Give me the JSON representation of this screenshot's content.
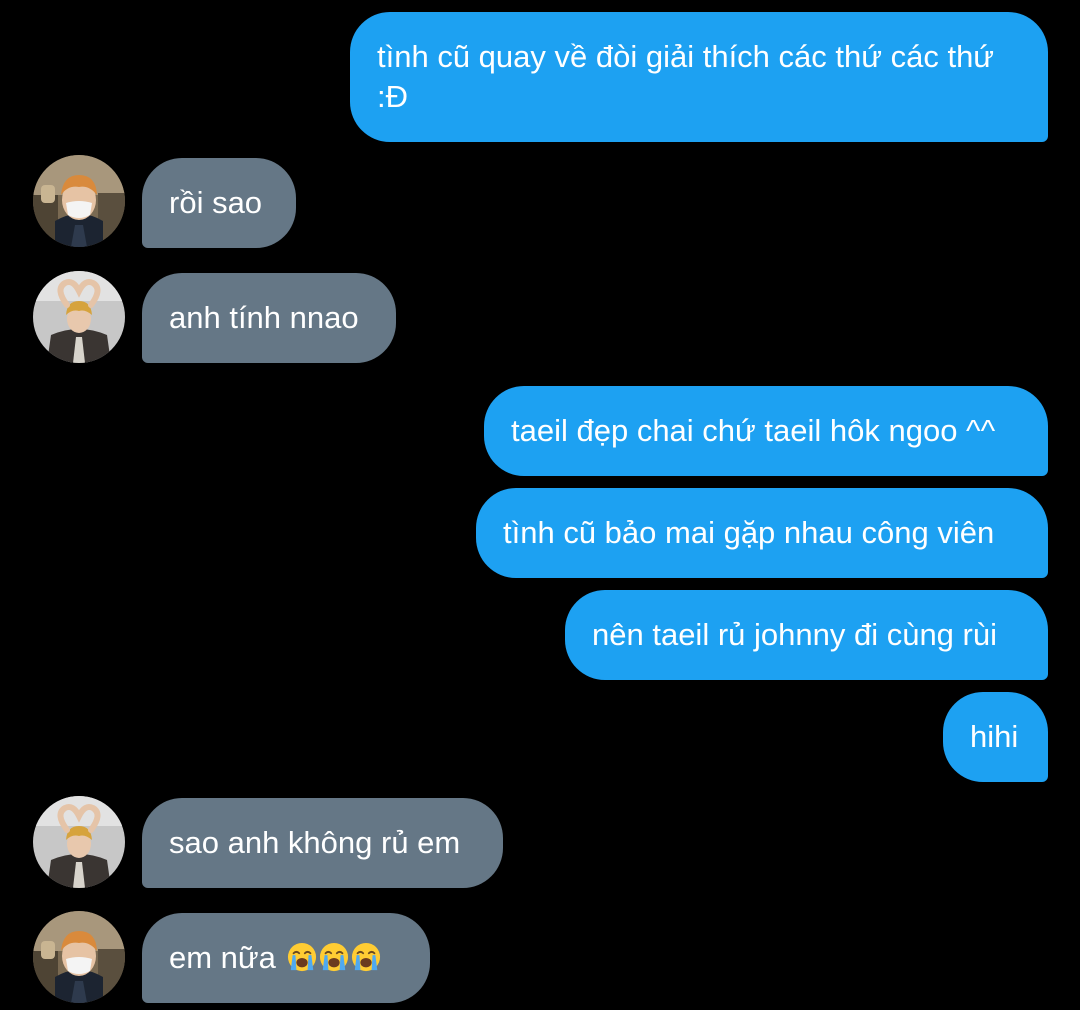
{
  "colors": {
    "sent_bubble": "#1da1f2",
    "received_bubble": "#657786",
    "background": "#000000",
    "text": "#ffffff"
  },
  "messages": [
    {
      "side": "sent",
      "text": "tình cũ quay về đòi giải thích các thứ các thứ :Đ"
    },
    {
      "side": "received",
      "avatar": "avatar-masked-user",
      "text": "rồi sao"
    },
    {
      "side": "received",
      "avatar": "avatar-heart-pose-user",
      "text": "anh tính nnao"
    },
    {
      "side": "sent",
      "text": "taeil đẹp chai chứ taeil hôk ngoo ^^"
    },
    {
      "side": "sent",
      "text": "tình cũ bảo mai gặp nhau công viên"
    },
    {
      "side": "sent",
      "text": "nên taeil rủ johnny đi cùng rùi"
    },
    {
      "side": "sent",
      "text": "hihi"
    },
    {
      "side": "received",
      "avatar": "avatar-heart-pose-user",
      "text": "sao anh không rủ em"
    },
    {
      "side": "received",
      "avatar": "avatar-masked-user",
      "text": "em nữa",
      "emojis": [
        "loudly-crying-face-icon",
        "loudly-crying-face-icon",
        "loudly-crying-face-icon"
      ]
    }
  ]
}
